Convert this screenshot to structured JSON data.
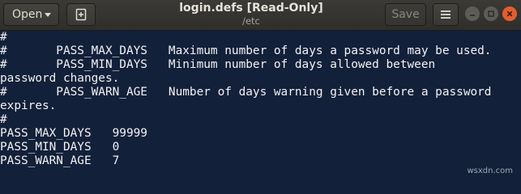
{
  "headerbar": {
    "open_label": "Open",
    "save_label": "Save",
    "title": "login.defs [Read-Only]",
    "subtitle": "/etc"
  },
  "icons": {
    "open_menu": "chevron-down-icon",
    "new_document": "new-document-icon",
    "app_menu": "hamburger-menu-icon",
    "minimize": "minimize-icon",
    "maximize": "maximize-icon",
    "close": "close-icon"
  },
  "editor": {
    "lines": [
      "#",
      "#       PASS_MAX_DAYS   Maximum number of days a password may be used.",
      "#       PASS_MIN_DAYS   Minimum number of days allowed between",
      "password changes.",
      "#       PASS_WARN_AGE   Number of days warning given before a password",
      "expires.",
      "#",
      "PASS_MAX_DAYS   99999",
      "PASS_MIN_DAYS   0",
      "PASS_WARN_AGE   7"
    ]
  },
  "watermark": "wsxdn.com",
  "colors": {
    "editor_bg": "#13203a",
    "headerbar_bg": "#33322f",
    "text": "#f2f2f2",
    "close_button": "#e45e2d"
  }
}
